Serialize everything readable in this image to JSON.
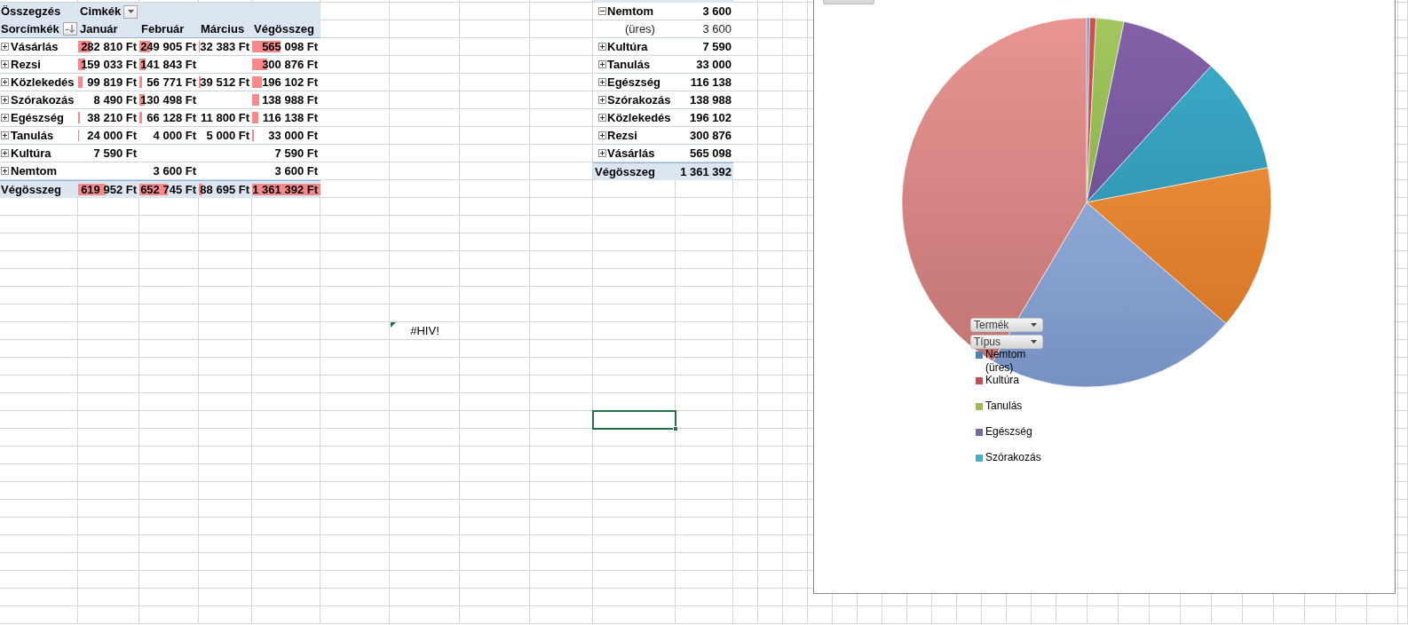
{
  "pivot_table": {
    "value_label": "Összegzés",
    "column_field": "Cimkék",
    "row_field": "Sorcímkék",
    "columns": [
      "Január",
      "Február",
      "Március",
      "Végösszeg"
    ],
    "rows": [
      {
        "label": "Vásárlás",
        "expanded": false,
        "cells": [
          {
            "text": "282 810 Ft",
            "level": 0.208
          },
          {
            "text": "249 905 Ft",
            "level": 0.184
          },
          {
            "text": "32 383 Ft",
            "level": 0.024
          },
          {
            "text": "565 098 Ft",
            "level": 0.415
          }
        ]
      },
      {
        "label": "Rezsi",
        "expanded": false,
        "cells": [
          {
            "text": "159 033 Ft",
            "level": 0.117
          },
          {
            "text": "141 843 Ft",
            "level": 0.104
          },
          null,
          {
            "text": "300 876 Ft",
            "level": 0.221
          }
        ]
      },
      {
        "label": "Közlekedés",
        "expanded": false,
        "cells": [
          {
            "text": "99 819 Ft",
            "level": 0.073
          },
          {
            "text": "56 771 Ft",
            "level": 0.042
          },
          {
            "text": "39 512 Ft",
            "level": 0.029
          },
          {
            "text": "196 102 Ft",
            "level": 0.144
          }
        ]
      },
      {
        "label": "Szórakozás",
        "expanded": false,
        "cells": [
          {
            "text": "8 490 Ft"
          },
          {
            "text": "130 498 Ft",
            "level": 0.096
          },
          null,
          {
            "text": "138 988 Ft",
            "level": 0.102
          }
        ]
      },
      {
        "label": "Egészség",
        "expanded": false,
        "cells": [
          {
            "text": "38 210 Ft",
            "level": 0.028
          },
          {
            "text": "66 128 Ft",
            "level": 0.049
          },
          {
            "text": "11 800 Ft"
          },
          {
            "text": "116 138 Ft",
            "level": 0.085
          }
        ]
      },
      {
        "label": "Tanulás",
        "expanded": false,
        "cells": [
          {
            "text": "24 000 Ft",
            "level": 0.018
          },
          {
            "text": "4 000 Ft"
          },
          {
            "text": "5 000 Ft"
          },
          {
            "text": "33 000 Ft",
            "level": 0.024
          }
        ]
      },
      {
        "label": "Kultúra",
        "expanded": false,
        "cells": [
          {
            "text": "7 590 Ft"
          },
          null,
          null,
          {
            "text": "7 590 Ft"
          }
        ]
      },
      {
        "label": "Nemtom",
        "expanded": false,
        "cells": [
          null,
          {
            "text": "3 600 Ft"
          },
          null,
          {
            "text": "3 600 Ft"
          }
        ]
      }
    ],
    "total": {
      "label": "Végösszeg",
      "cells": [
        {
          "text": "619 952 Ft",
          "level": 0.455
        },
        {
          "text": "652 745 Ft",
          "level": 0.479
        },
        {
          "text": "88 695 Ft",
          "level": 0.065
        },
        {
          "text": "1 361 392 Ft",
          "level": 1
        }
      ]
    }
  },
  "summary_table": {
    "rows": [
      {
        "label": "Nemtom",
        "expanded": true,
        "value": "3 600",
        "children": [
          {
            "label": "(üres)",
            "value": "3 600"
          }
        ]
      },
      {
        "label": "Kultúra",
        "expanded": false,
        "value": "7 590"
      },
      {
        "label": "Tanulás",
        "expanded": false,
        "value": "33 000"
      },
      {
        "label": "Egészség",
        "expanded": false,
        "value": "116 138"
      },
      {
        "label": "Szórakozás",
        "expanded": false,
        "value": "138 988"
      },
      {
        "label": "Közlekedés",
        "expanded": false,
        "value": "196 102"
      },
      {
        "label": "Rezsi",
        "expanded": false,
        "value": "300 876"
      },
      {
        "label": "Vásárlás",
        "expanded": false,
        "value": "565 098"
      }
    ],
    "total": {
      "label": "Végösszeg",
      "value": "1 361 392"
    }
  },
  "cells": [
    {
      "kind": "error",
      "value": "#HIV!",
      "selected": false
    },
    {
      "kind": "blank",
      "selected": true
    }
  ],
  "chart": {
    "field_buttons": [
      "Termék",
      "Típus"
    ],
    "legend": [
      {
        "label": "Nemtom",
        "sublabel": "(üres)",
        "color": "#4f81bd"
      },
      {
        "label": "Kultúra",
        "color": "#c0504d"
      },
      {
        "label": "Tanulás",
        "color": "#9bbb59"
      },
      {
        "label": "Egészség",
        "color": "#8064a2"
      },
      {
        "label": "Szórakozás",
        "color": "#4bacc6"
      }
    ]
  }
}
